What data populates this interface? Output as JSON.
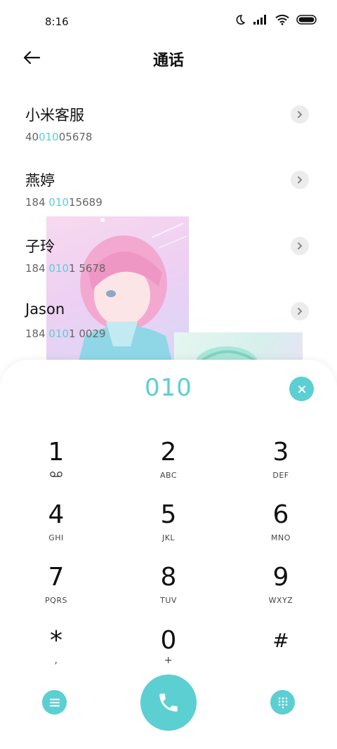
{
  "status_bar": {
    "time": "8:16",
    "icons": [
      "moon-icon",
      "signal-icon",
      "wifi-icon",
      "battery-icon"
    ]
  },
  "header": {
    "title": "通话",
    "back_icon": "arrow-left-icon"
  },
  "contacts": [
    {
      "name": "小米客服",
      "number_pre": "40",
      "number_hl": "010",
      "number_post": "05678"
    },
    {
      "name": "燕婷",
      "number_pre": "184 ",
      "number_hl": "010",
      "number_post": "15689"
    },
    {
      "name": "子玲",
      "number_pre": "184 ",
      "number_hl": "010",
      "number_post": "1 5678"
    },
    {
      "name": "Jason",
      "number_pre": "184 ",
      "number_hl": "010",
      "number_post": "1 0029"
    }
  ],
  "dialer": {
    "input": "010",
    "keys": [
      {
        "digit": "1",
        "letters": ""
      },
      {
        "digit": "2",
        "letters": "ABC"
      },
      {
        "digit": "3",
        "letters": "DEF"
      },
      {
        "digit": "4",
        "letters": "GHI"
      },
      {
        "digit": "5",
        "letters": "JKL"
      },
      {
        "digit": "6",
        "letters": "MNO"
      },
      {
        "digit": "7",
        "letters": "PQRS"
      },
      {
        "digit": "8",
        "letters": "TUV"
      },
      {
        "digit": "9",
        "letters": "WXYZ"
      },
      {
        "digit": "*",
        "letters": ","
      },
      {
        "digit": "0",
        "letters": "+"
      },
      {
        "digit": "#",
        "letters": ""
      }
    ]
  },
  "colors": {
    "accent": "#5ccfd2",
    "text": "#111111",
    "secondary_text": "#666666"
  }
}
